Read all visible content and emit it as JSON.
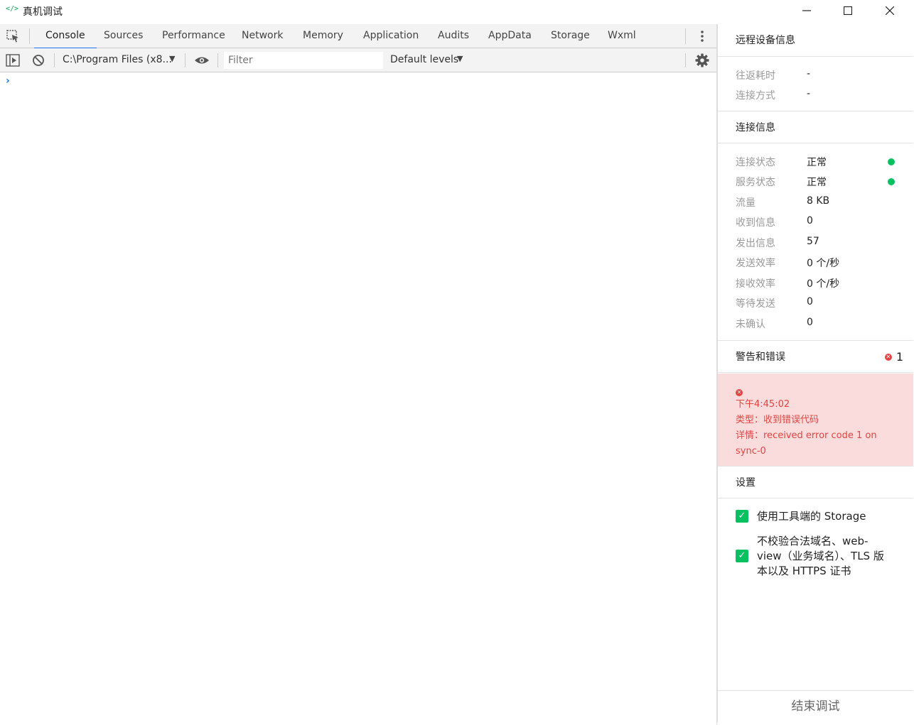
{
  "window": {
    "logo": "</>",
    "title": "真机调试"
  },
  "devtools": {
    "tabs": [
      "Console",
      "Sources",
      "Performance",
      "Network",
      "Memory",
      "Application",
      "Audits",
      "AppData",
      "Storage",
      "Wxml"
    ],
    "active_tab": "Console",
    "toolbar": {
      "context": "C:\\Program Files (x8...",
      "filter_placeholder": "Filter",
      "levels": "Default levels"
    },
    "prompt": "›"
  },
  "panel": {
    "device_info": {
      "title": "远程设备信息",
      "rows": [
        {
          "label": "往返耗时",
          "value": "-"
        },
        {
          "label": "连接方式",
          "value": "-"
        }
      ]
    },
    "connection": {
      "title": "连接信息",
      "rows": [
        {
          "label": "连接状态",
          "value": "正常"
        },
        {
          "label": "服务状态",
          "value": "正常"
        },
        {
          "label": "流量",
          "value": "8 KB"
        },
        {
          "label": "收到信息",
          "value": "0"
        },
        {
          "label": "发出信息",
          "value": "57"
        },
        {
          "label": "发送效率",
          "value": "0 个/秒"
        },
        {
          "label": "接收效率",
          "value": "0 个/秒"
        },
        {
          "label": "等待发送",
          "value": "0"
        },
        {
          "label": "未确认",
          "value": "0"
        }
      ],
      "status_color": "#07c160"
    },
    "warnings": {
      "title": "警告和错误",
      "error_count": "1",
      "error_time": "下午4:45:02",
      "error_type": "类型：收到错误代码",
      "error_detail_1": "详情：received error code 1 on",
      "error_detail_2": "sync-0",
      "error_color": "#e64340"
    },
    "settings": {
      "title": "设置",
      "option1": "使用工具端的 Storage",
      "option2_line1": "不校验合法域名、web-",
      "option2_line2": "view（业务域名）、TLS 版",
      "option2_line3": "本以及 HTTPS 证书",
      "option1_checked": true,
      "option2_checked": true
    },
    "end_button": "结束调试"
  }
}
